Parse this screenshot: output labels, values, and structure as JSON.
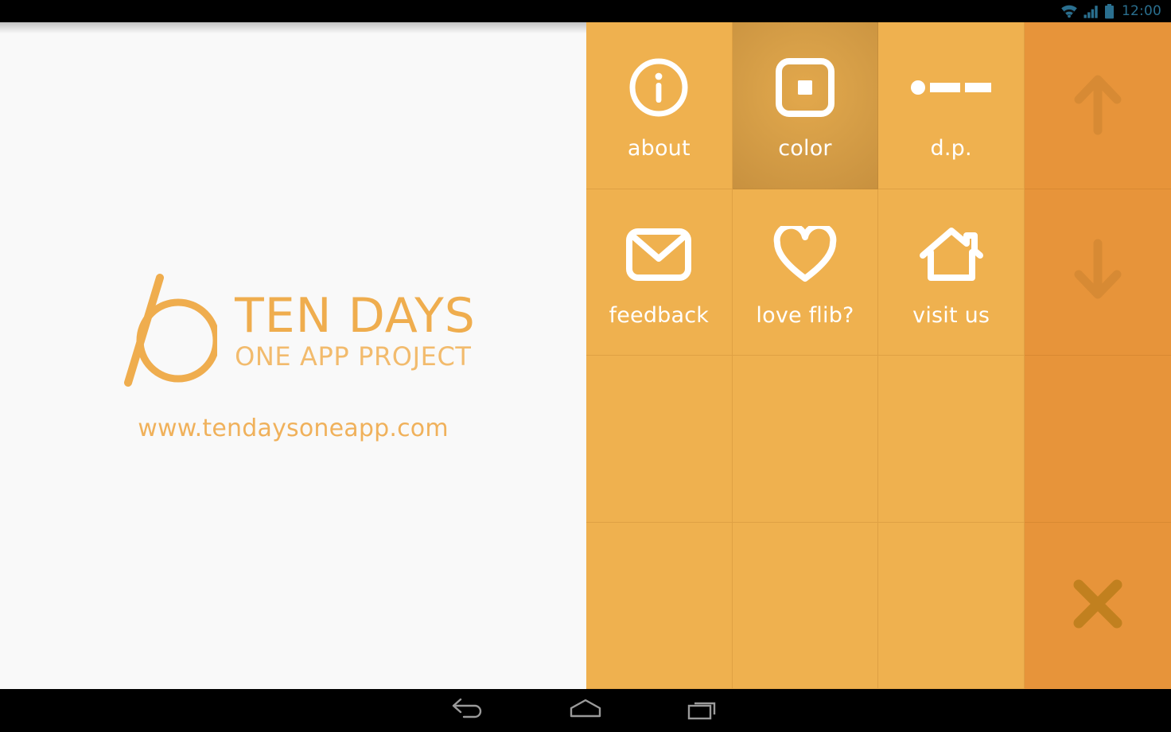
{
  "status_bar": {
    "time": "12:00",
    "icons": [
      "wifi-icon",
      "cellular-signal-icon",
      "battery-icon"
    ],
    "tint": "#2a6f8f",
    "background": "#000000"
  },
  "left_panel": {
    "background": "#f9f9f9",
    "logo": {
      "mark": "ten-slash-zero-logo",
      "title": "TEN DAYS",
      "subtitle": "ONE APP PROJECT",
      "url": "www.tendaysoneapp.com",
      "title_color": "#efad4e",
      "subtitle_color": "#f2bb6d",
      "url_color": "#f0b15b"
    }
  },
  "menu_panel": {
    "background": "#efb14f",
    "selected_background": "#cf9641",
    "label_color": "#ffffff",
    "tiles": [
      {
        "id": "about",
        "label": "about",
        "icon": "info-circle-icon",
        "selected": false,
        "empty": false
      },
      {
        "id": "color",
        "label": "color",
        "icon": "color-square-icon",
        "selected": true,
        "empty": false
      },
      {
        "id": "dp",
        "label": "d.p.",
        "icon": "dot-dash-icon",
        "selected": false,
        "empty": false
      },
      {
        "id": "feedback",
        "label": "feedback",
        "icon": "envelope-icon",
        "selected": false,
        "empty": false
      },
      {
        "id": "loveflib",
        "label": "love flib?",
        "icon": "heart-icon",
        "selected": false,
        "empty": false
      },
      {
        "id": "visitus",
        "label": "visit us",
        "icon": "house-icon",
        "selected": false,
        "empty": false
      },
      {
        "id": "empty-1",
        "label": "",
        "icon": "",
        "selected": false,
        "empty": true
      },
      {
        "id": "empty-2",
        "label": "",
        "icon": "",
        "selected": false,
        "empty": true
      },
      {
        "id": "empty-3",
        "label": "",
        "icon": "",
        "selected": false,
        "empty": true
      },
      {
        "id": "empty-4",
        "label": "",
        "icon": "",
        "selected": false,
        "empty": true
      },
      {
        "id": "empty-5",
        "label": "",
        "icon": "",
        "selected": false,
        "empty": true
      },
      {
        "id": "empty-6",
        "label": "",
        "icon": "",
        "selected": false,
        "empty": true
      }
    ]
  },
  "side_panel": {
    "background": "#e7943a",
    "glyph_color": "#d78a34",
    "close_color": "#c1801f",
    "cells": [
      {
        "id": "scroll-up",
        "icon": "arrow-up-icon"
      },
      {
        "id": "scroll-down",
        "icon": "arrow-down-icon"
      },
      {
        "id": "spacer",
        "icon": ""
      },
      {
        "id": "close",
        "icon": "close-x-icon"
      }
    ]
  },
  "nav_bar": {
    "background": "#000000",
    "buttons": [
      {
        "id": "back",
        "icon": "back-arrow-icon"
      },
      {
        "id": "home",
        "icon": "home-pentagon-icon"
      },
      {
        "id": "recents",
        "icon": "recent-apps-icon"
      }
    ]
  }
}
